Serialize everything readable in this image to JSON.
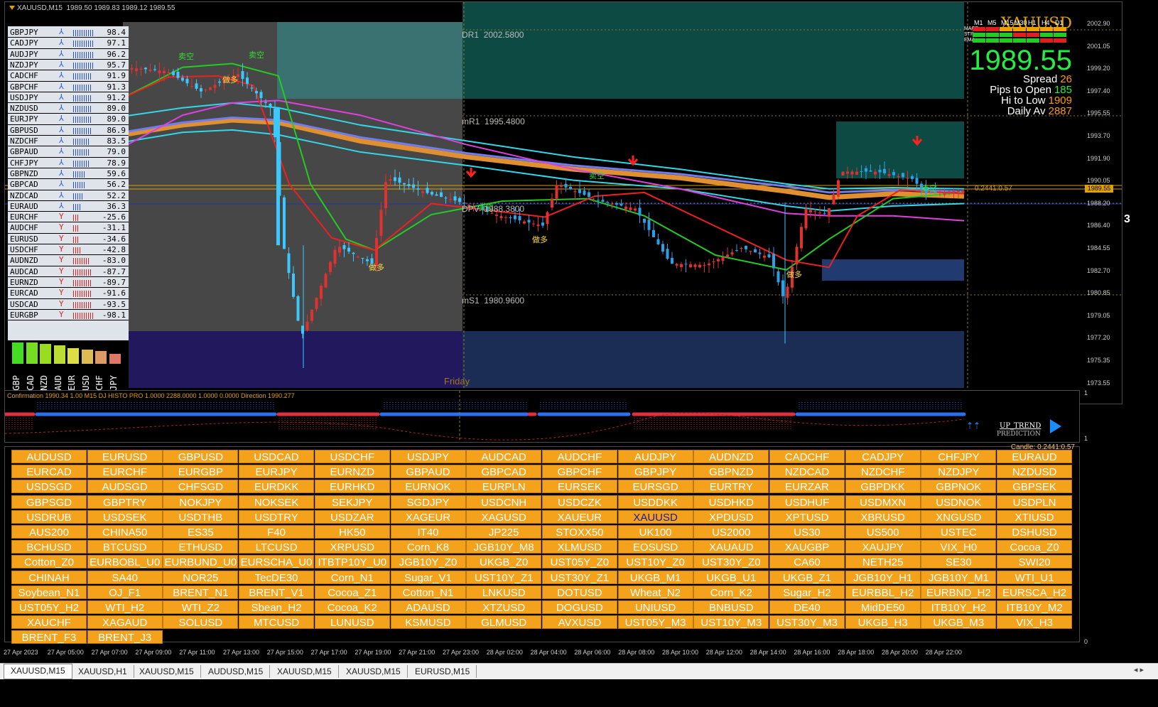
{
  "chart": {
    "title": "XAUUSD,M15",
    "ohlc": "1989.50 1989.83 1989.12 1989.55",
    "symbol_watermark": "XAUUSD",
    "day_label": "Friday"
  },
  "strength_table": [
    {
      "pair": "GBPJPY",
      "dir": "up",
      "value": "98.4"
    },
    {
      "pair": "CADJPY",
      "dir": "up",
      "value": "97.1"
    },
    {
      "pair": "AUDJPY",
      "dir": "up",
      "value": "96.2"
    },
    {
      "pair": "NZDJPY",
      "dir": "up",
      "value": "95.7"
    },
    {
      "pair": "CADCHF",
      "dir": "up",
      "value": "91.9"
    },
    {
      "pair": "GBPCHF",
      "dir": "up",
      "value": "91.3"
    },
    {
      "pair": "USDJPY",
      "dir": "up",
      "value": "91.2"
    },
    {
      "pair": "NZDUSD",
      "dir": "up",
      "value": "89.0"
    },
    {
      "pair": "EURJPY",
      "dir": "up",
      "value": "89.0"
    },
    {
      "pair": "GBPUSD",
      "dir": "up",
      "value": "86.9"
    },
    {
      "pair": "NZDCHF",
      "dir": "up",
      "value": "83.5"
    },
    {
      "pair": "GBPAUD",
      "dir": "up",
      "value": "79.0"
    },
    {
      "pair": "CHFJPY",
      "dir": "up",
      "value": "78.9"
    },
    {
      "pair": "GBPNZD",
      "dir": "up",
      "value": "59.6"
    },
    {
      "pair": "GBPCAD",
      "dir": "up",
      "value": "56.2"
    },
    {
      "pair": "NZDCAD",
      "dir": "up",
      "value": "52.2"
    },
    {
      "pair": "EURAUD",
      "dir": "up",
      "value": "36.3"
    },
    {
      "pair": "EURCHF",
      "dir": "down",
      "value": "-25.6"
    },
    {
      "pair": "AUDCHF",
      "dir": "down",
      "value": "-31.1"
    },
    {
      "pair": "EURUSD",
      "dir": "down",
      "value": "-34.6"
    },
    {
      "pair": "USDCHF",
      "dir": "down",
      "value": "-42.8"
    },
    {
      "pair": "AUDNZD",
      "dir": "down",
      "value": "-83.0"
    },
    {
      "pair": "AUDCAD",
      "dir": "down",
      "value": "-87.7"
    },
    {
      "pair": "EURNZD",
      "dir": "down",
      "value": "-89.7"
    },
    {
      "pair": "EURCAD",
      "dir": "down",
      "value": "-91.6"
    },
    {
      "pair": "USDCAD",
      "dir": "down",
      "value": "-93.5"
    },
    {
      "pair": "EURGBP",
      "dir": "down",
      "value": "-98.1"
    }
  ],
  "currencies": [
    "GBP",
    "CAD",
    "NZD",
    "AUD",
    "EUR",
    "USD",
    "CHF",
    "JPY"
  ],
  "pivots": {
    "dr1": "DR1",
    "dr1_value": "2002.5800",
    "mr1": "mR1",
    "mr1_value": "1995.4800",
    "dpv": "DPV",
    "dpv_value": "1988.3800",
    "ms1": "mS1",
    "ms1_value": "1980.9600"
  },
  "signals": {
    "sell": "卖空",
    "buy": "做多"
  },
  "info_panel": {
    "price": "1989.55",
    "spread_label": "Spread",
    "spread_value": "26",
    "pips_label": "Pips to Open",
    "pips_value": "185",
    "hilo_label": "Hi to Low",
    "hilo_value": "1909",
    "daily_label": "Daily Av",
    "daily_value": "2887",
    "timeframes": [
      "M1",
      "M5",
      "M15",
      "M30",
      "H1",
      "H4",
      "D1"
    ],
    "indicators": [
      "MACD",
      "STR",
      "EMA"
    ]
  },
  "price_axis": [
    "2002.90",
    "2001.05",
    "1999.20",
    "1997.40",
    "1995.55",
    "1993.70",
    "1991.90",
    "1990.05",
    "1988.20",
    "1986.40",
    "1984.55",
    "1982.70",
    "1980.85",
    "1979.05",
    "1977.20",
    "1975.35",
    "1973.55"
  ],
  "price_tag": "1989.55",
  "level_label": "0.2441:0.57",
  "sub_window": {
    "title": "Confirmation 1990.34 1.00  M15 DJ HISTO PRO 1.0000 2288.0000 1.0000 0.0000  Direction 1990.277",
    "trend": "UP_TREND",
    "prediction": "PREDICTION",
    "scale_top": "1",
    "scale_bottom": "1"
  },
  "candle_info": "Candle: 0.2441:0.57",
  "symbols": [
    "AUDUSD",
    "EURUSD",
    "GBPUSD",
    "USDCAD",
    "USDCHF",
    "USDJPY",
    "AUDCAD",
    "AUDCHF",
    "AUDJPY",
    "AUDNZD",
    "CADCHF",
    "CADJPY",
    "CHFJPY",
    "EURAUD",
    "EURCAD",
    "EURCHF",
    "EURGBP",
    "EURJPY",
    "EURNZD",
    "GBPAUD",
    "GBPCAD",
    "GBPCHF",
    "GBPJPY",
    "GBPNZD",
    "NZDCAD",
    "NZDCHF",
    "NZDJPY",
    "NZDUSD",
    "USDSGD",
    "AUDSGD",
    "CHFSGD",
    "EURDKK",
    "EURHKD",
    "EURNOK",
    "EURPLN",
    "EURSEK",
    "EURSGD",
    "EURTRY",
    "EURZAR",
    "GBPDKK",
    "GBPNOK",
    "GBPSEK",
    "GBPSGD",
    "GBPTRY",
    "NOKJPY",
    "NOKSEK",
    "SEKJPY",
    "SGDJPY",
    "USDCNH",
    "USDCZK",
    "USDDKK",
    "USDHKD",
    "USDHUF",
    "USDMXN",
    "USDNOK",
    "USDPLN",
    "USDRUB",
    "USDSEK",
    "USDTHB",
    "USDTRY",
    "USDZAR",
    "XAGEUR",
    "XAGUSD",
    "XAUEUR",
    "XAUUSD",
    "XPDUSD",
    "XPTUSD",
    "XBRUSD",
    "XNGUSD",
    "XTIUSD",
    "AUS200",
    "CHINA50",
    "ES35",
    "F40",
    "HK50",
    "IT40",
    "JP225",
    "STOXX50",
    "UK100",
    "US2000",
    "US30",
    "US500",
    "USTEC",
    "DSHUSD",
    "BCHUSD",
    "BTCUSD",
    "ETHUSD",
    "LTCUSD",
    "XRPUSD",
    "Corn_K8",
    "JGB10Y_M8",
    "XLMUSD",
    "EOSUSD",
    "XAUAUD",
    "XAUGBP",
    "XAUJPY",
    "VIX_H0",
    "Cocoa_Z0",
    "Cotton_Z0",
    "EURBOBL_U0",
    "EURBUND_U0",
    "EURSCHA_U0",
    "ITBTP10Y_U0",
    "JGB10Y_Z0",
    "UKGB_Z0",
    "UST05Y_Z0",
    "UST10Y_Z0",
    "UST30Y_Z0",
    "CA60",
    "NETH25",
    "SE30",
    "SWI20",
    "CHINAH",
    "SA40",
    "NOR25",
    "TecDE30",
    "Corn_N1",
    "Sugar_V1",
    "UST10Y_Z1",
    "UST30Y_Z1",
    "UKGB_M1",
    "UKGB_U1",
    "UKGB_Z1",
    "JGB10Y_H1",
    "JGB10Y_M1",
    "WTI_U1",
    "Soybean_N1",
    "OJ_F1",
    "BRENT_N1",
    "BRENT_V1",
    "Cocoa_Z1",
    "Cotton_N1",
    "LNKUSD",
    "DOTUSD",
    "Wheat_N2",
    "Corn_K2",
    "Sugar_H2",
    "EURBBL_H2",
    "EURBND_H2",
    "EURSCA_H2",
    "UST05Y_H2",
    "WTI_H2",
    "WTI_Z2",
    "Sbean_H2",
    "Cocoa_K2",
    "ADAUSD",
    "XTZUSD",
    "DOGUSD",
    "UNIUSD",
    "BNBUSD",
    "DE40",
    "MidDE50",
    "ITB10Y_H2",
    "ITB10Y_M2",
    "XAUCHF",
    "XAGAUD",
    "SOLUSD",
    "MTCUSD",
    "LUNUSD",
    "KSMUSD",
    "GLMUSD",
    "AVXUSD",
    "UST05Y_M3",
    "UST10Y_M3",
    "UST30Y_M3",
    "UKGB_H3",
    "UKGB_M3",
    "VIX_H3",
    "BRENT_F3",
    "BRENT_J3"
  ],
  "selected_symbol": "XAUUSD",
  "time_axis": [
    "27 Apr 2023",
    "27 Apr 05:00",
    "27 Apr 07:00",
    "27 Apr 09:00",
    "27 Apr 11:00",
    "27 Apr 13:00",
    "27 Apr 15:00",
    "27 Apr 17:00",
    "27 Apr 19:00",
    "27 Apr 21:00",
    "27 Apr 23:00",
    "28 Apr 02:00",
    "28 Apr 04:00",
    "28 Apr 06:00",
    "28 Apr 08:00",
    "28 Apr 10:00",
    "28 Apr 12:00",
    "28 Apr 14:00",
    "28 Apr 16:00",
    "28 Apr 18:00",
    "28 Apr 20:00",
    "28 Apr 22:00"
  ],
  "tabs": [
    "XAUUSD,M15",
    "XAUUSD,H1",
    "XAUUSD,M15",
    "AUDUSD,M15",
    "XAUUSD,M15",
    "XAUUSD,M15",
    "EURUSD,M15"
  ],
  "colors": {
    "buy_bar": "#2a70f0",
    "sell_bar": "#e03030",
    "button": "#f4a21b",
    "price_green": "#22ee44"
  }
}
